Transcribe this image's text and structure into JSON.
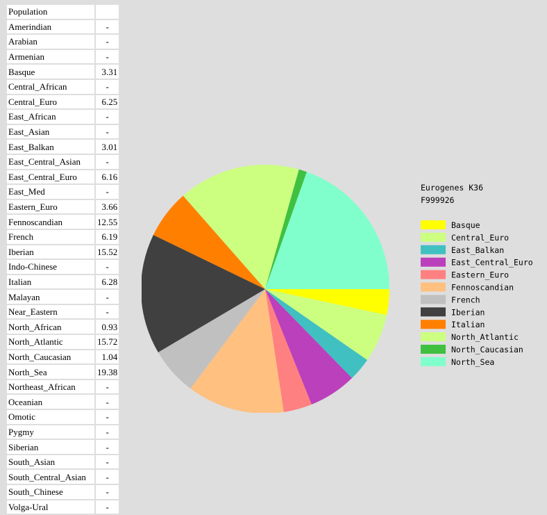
{
  "table": {
    "header": {
      "label": "Population",
      "value": ""
    },
    "rows": [
      {
        "name": "Amerindian",
        "value": "-"
      },
      {
        "name": "Arabian",
        "value": "-"
      },
      {
        "name": "Armenian",
        "value": "-"
      },
      {
        "name": "Basque",
        "value": "3.31"
      },
      {
        "name": "Central_African",
        "value": "-"
      },
      {
        "name": "Central_Euro",
        "value": "6.25"
      },
      {
        "name": "East_African",
        "value": "-"
      },
      {
        "name": "East_Asian",
        "value": "-"
      },
      {
        "name": "East_Balkan",
        "value": "3.01"
      },
      {
        "name": "East_Central_Asian",
        "value": "-"
      },
      {
        "name": "East_Central_Euro",
        "value": "6.16"
      },
      {
        "name": "East_Med",
        "value": "-"
      },
      {
        "name": "Eastern_Euro",
        "value": "3.66"
      },
      {
        "name": "Fennoscandian",
        "value": "12.55"
      },
      {
        "name": "French",
        "value": "6.19"
      },
      {
        "name": "Iberian",
        "value": "15.52"
      },
      {
        "name": "Indo-Chinese",
        "value": "-"
      },
      {
        "name": "Italian",
        "value": "6.28"
      },
      {
        "name": "Malayan",
        "value": "-"
      },
      {
        "name": "Near_Eastern",
        "value": "-"
      },
      {
        "name": "North_African",
        "value": "0.93"
      },
      {
        "name": "North_Atlantic",
        "value": "15.72"
      },
      {
        "name": "North_Caucasian",
        "value": "1.04"
      },
      {
        "name": "North_Sea",
        "value": "19.38"
      },
      {
        "name": "Northeast_African",
        "value": "-"
      },
      {
        "name": "Oceanian",
        "value": "-"
      },
      {
        "name": "Omotic",
        "value": "-"
      },
      {
        "name": "Pygmy",
        "value": "-"
      },
      {
        "name": "Siberian",
        "value": "-"
      },
      {
        "name": "South_Asian",
        "value": "-"
      },
      {
        "name": "South_Central_Asian",
        "value": "-"
      },
      {
        "name": "South_Chinese",
        "value": "-"
      },
      {
        "name": "Volga-Ural",
        "value": "-"
      }
    ]
  },
  "chart_data": {
    "type": "pie",
    "title": "Eurogenes K36",
    "subtitle": "F999926",
    "start_angle": "3 o'clock",
    "direction": "clockwise",
    "legend_position": "right",
    "slices": [
      {
        "label": "Basque",
        "value": 3.31,
        "color": "#ffff00"
      },
      {
        "label": "Central_Euro",
        "value": 6.25,
        "color": "#ccff80"
      },
      {
        "label": "East_Balkan",
        "value": 3.01,
        "color": "#40c0c0"
      },
      {
        "label": "East_Central_Euro",
        "value": 6.16,
        "color": "#bb40bb"
      },
      {
        "label": "Eastern_Euro",
        "value": 3.66,
        "color": "#ff8080"
      },
      {
        "label": "Fennoscandian",
        "value": 12.55,
        "color": "#ffc080"
      },
      {
        "label": "French",
        "value": 6.19,
        "color": "#c0c0c0"
      },
      {
        "label": "Iberian",
        "value": 15.52,
        "color": "#404040"
      },
      {
        "label": "Italian",
        "value": 6.28,
        "color": "#ff8000"
      },
      {
        "label": "North_Atlantic",
        "value": 15.72,
        "color": "#ccff80"
      },
      {
        "label": "North_Caucasian",
        "value": 1.04,
        "color": "#40c040"
      },
      {
        "label": "North_Sea",
        "value": 19.38,
        "color": "#80ffcc"
      }
    ]
  }
}
